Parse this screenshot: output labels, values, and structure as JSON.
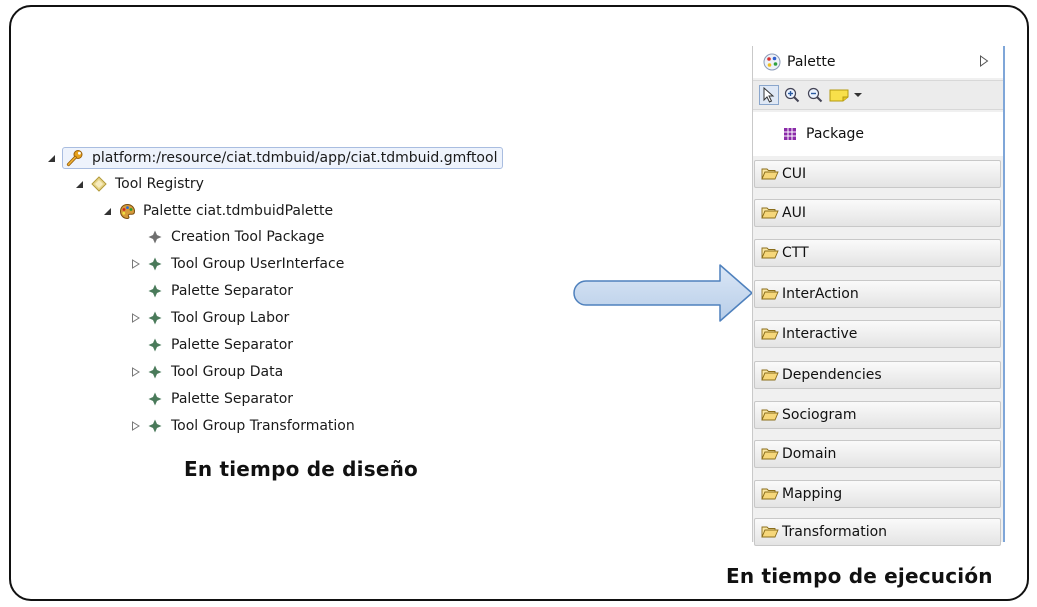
{
  "tree": {
    "root": "platform:/resource/ciat.tdmbuid/app/ciat.tdmbuid.gmftool",
    "registry": "Tool Registry",
    "palette": "Palette ciat.tdmbuidPalette",
    "items": [
      {
        "label": "Creation Tool Package",
        "expandable": false
      },
      {
        "label": "Tool Group UserInterface",
        "expandable": true
      },
      {
        "label": "Palette Separator",
        "expandable": false
      },
      {
        "label": "Tool Group Labor",
        "expandable": true
      },
      {
        "label": "Palette Separator",
        "expandable": false
      },
      {
        "label": "Tool Group Data",
        "expandable": true
      },
      {
        "label": "Palette Separator",
        "expandable": false
      },
      {
        "label": "Tool Group Transformation",
        "expandable": true
      }
    ]
  },
  "captions": {
    "design": "En tiempo de diseño",
    "runtime": "En tiempo de ejecución"
  },
  "palette": {
    "title": "Palette",
    "tools": [
      "select-tool",
      "zoom-in-tool",
      "zoom-out-tool",
      "note-tool"
    ],
    "entry": "Package",
    "drawers": [
      "CUI",
      "AUI",
      "CTT",
      "InterAction",
      "Interactive",
      "Dependencies",
      "Sociogram",
      "Domain",
      "Mapping",
      "Transformation"
    ]
  },
  "colors": {
    "arrow_fill": "#c5d9f1",
    "arrow_stroke": "#4f81bd",
    "folder": "#f6d77a",
    "palette_border": "#7fa6d8"
  }
}
